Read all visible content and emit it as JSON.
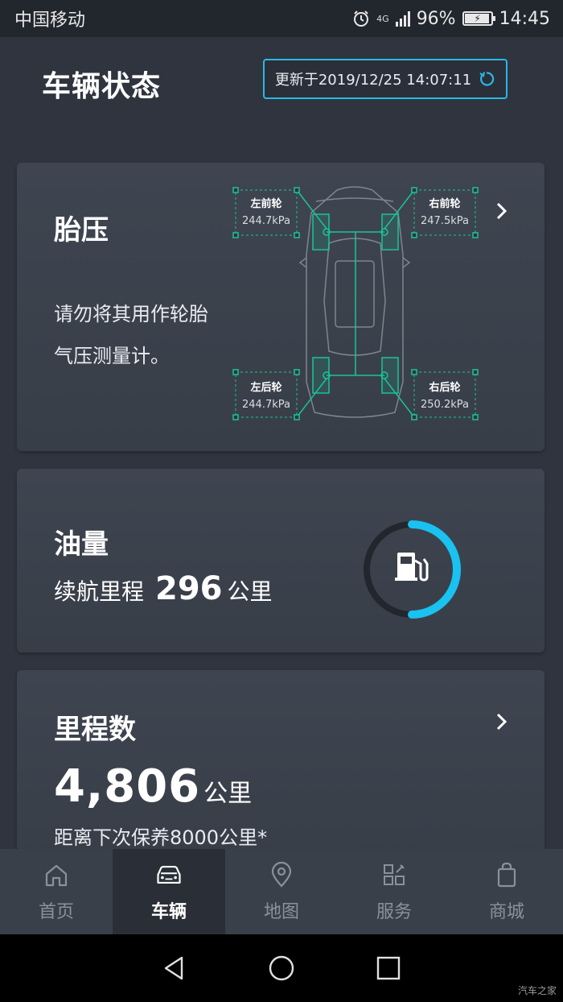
{
  "status_bar": {
    "carrier": "中国移动",
    "network": "4G",
    "battery": "96%",
    "time": "14:45"
  },
  "header": {
    "title": "车辆状态",
    "updated": "更新于2019/12/25 14:07:11"
  },
  "tire_card": {
    "title": "胎压",
    "note_line1": "请勿将其用作轮胎",
    "note_line2": "气压测量计。",
    "tires": {
      "front_left": {
        "label": "左前轮",
        "value": "244.7kPa"
      },
      "front_right": {
        "label": "右前轮",
        "value": "247.5kPa"
      },
      "rear_left": {
        "label": "左后轮",
        "value": "244.7kPa"
      },
      "rear_right": {
        "label": "右后轮",
        "value": "250.2kPa"
      }
    }
  },
  "fuel_card": {
    "title": "油量",
    "range_label": "续航里程",
    "range_value": "296",
    "range_unit": "公里",
    "fuel_level_fraction": 0.5
  },
  "odometer_card": {
    "title": "里程数",
    "value": "4,806",
    "unit": "公里",
    "service_note": "距离下次保养8000公里*"
  },
  "bottom_nav": [
    {
      "label": "首页",
      "icon": "home-icon",
      "active": false
    },
    {
      "label": "车辆",
      "icon": "car-icon",
      "active": true
    },
    {
      "label": "地图",
      "icon": "map-pin-icon",
      "active": false
    },
    {
      "label": "服务",
      "icon": "services-icon",
      "active": false
    },
    {
      "label": "商城",
      "icon": "shopping-bag-icon",
      "active": false
    }
  ],
  "watermark": "汽车之家",
  "colors": {
    "accent": "#27b9e6",
    "diagram_green": "#19c39a",
    "background": "#2f343e"
  }
}
